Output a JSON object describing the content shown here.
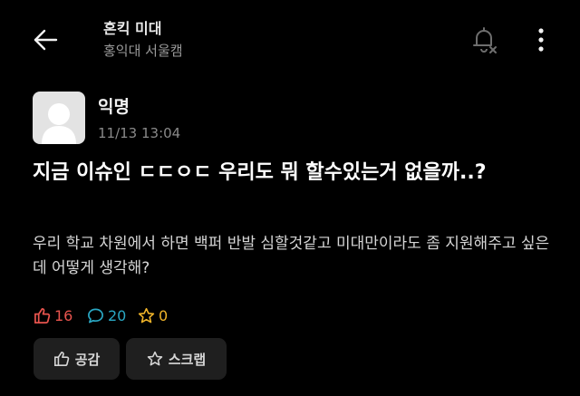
{
  "header": {
    "title": "혼킥 미대",
    "subtitle": "홍익대 서울캠",
    "icons": {
      "back": "arrow-left-icon",
      "notification": "bell-off-icon",
      "more": "more-vertical-icon"
    }
  },
  "post": {
    "author": "익명",
    "timestamp": "11/13 13:04",
    "title": "지금 이슈인 ㄷㄷㅇㄷ 우리도 뭐 할수있는거 없을까..?",
    "body": "우리 학교 차원에서 하면 백퍼 반발 심할것같고 미대만이라도 좀 지원해주고 싶은데 어떻게 생각해?",
    "stats": {
      "likes": "16",
      "comments": "20",
      "scraps": "0"
    }
  },
  "actions": {
    "like_label": "공감",
    "scrap_label": "스크랩"
  },
  "colors": {
    "background": "#000000",
    "like": "#e8544e",
    "comment": "#2aa8c4",
    "scrap": "#f0b429",
    "button_bg": "#1f1f1f"
  }
}
